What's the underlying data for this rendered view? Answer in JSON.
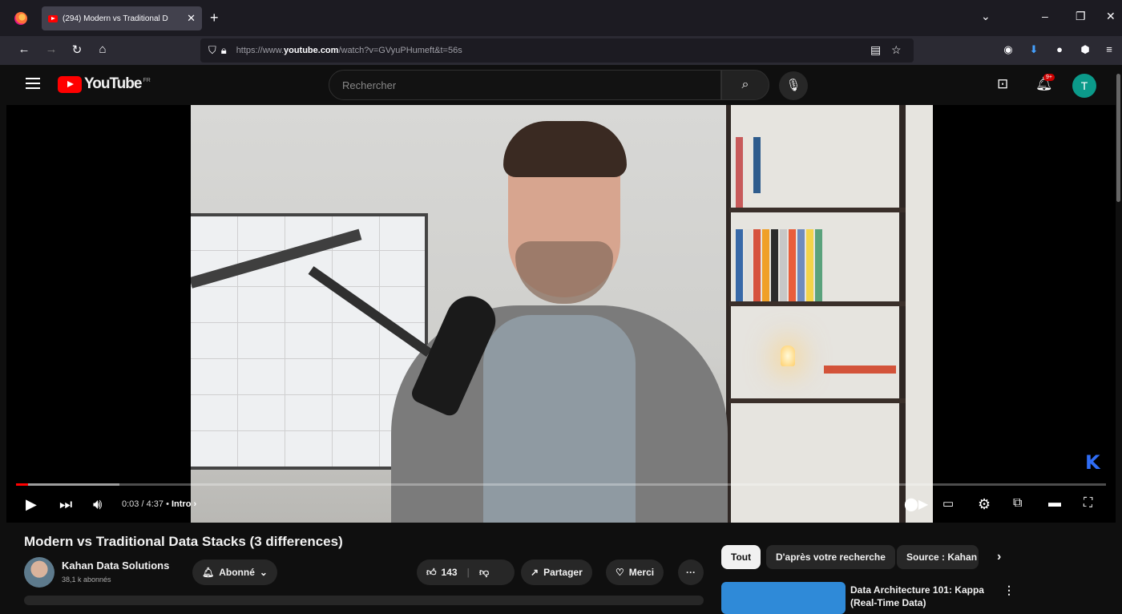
{
  "browser": {
    "tab_title": "(294) Modern vs Traditional D",
    "tab_close": "✕",
    "new_tab": "+",
    "url_prefix": "https://www.",
    "url_domain": "youtube.com",
    "url_path": "/watch?v=GVyuPHumeft&t=56s"
  },
  "youtube": {
    "logo_text": "YouTube",
    "logo_region": "FR",
    "search_placeholder": "Rechercher",
    "notification_count": "9+",
    "avatar_letter": "T"
  },
  "player": {
    "current_time": "0:03",
    "duration": "4:37",
    "chapter": "Intro",
    "chapter_arrow": "›",
    "progress_fraction": 0.011,
    "buffer_fraction": 0.095,
    "overlay_logo": "K"
  },
  "video": {
    "title": "Modern vs Traditional Data Stacks (3 differences)",
    "channel_name": "Kahan Data Solutions",
    "subscribers": "38,1 k abonnés",
    "subscribed_label": "Abonné",
    "like_count": "143",
    "share_label": "Partager",
    "thanks_label": "Merci",
    "more_label": "···"
  },
  "recommendations": {
    "chips": [
      "Tout",
      "D'après votre recherche",
      "Source : Kahan"
    ],
    "chips_next": "›",
    "first_title": "Data Architecture 101: Kappa (Real-Time Data)"
  },
  "colors": {
    "yt_red": "#ff0000",
    "avatar_teal": "#0b9a8a",
    "bg": "#0f0f0f"
  }
}
